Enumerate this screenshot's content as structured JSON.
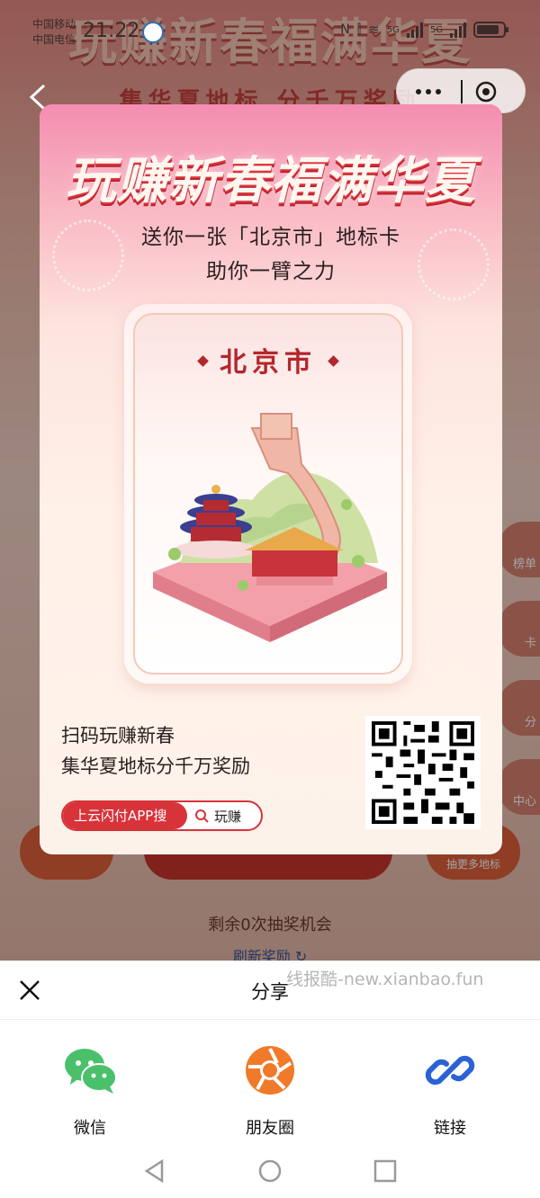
{
  "status_bar": {
    "carrier1": "中国移动",
    "carrier2": "中国电信",
    "time": "21:22",
    "network1": "5G",
    "network2": "5G"
  },
  "background_app": {
    "title": "玩赚新春福满华夏",
    "subtitle": "集华夏地标 分千万奖励",
    "side_buttons": [
      "榜单",
      "卡",
      "分",
      "中心"
    ],
    "bottom_hint": "抽更多地标",
    "remaining_draws": "剩余0次抽奖机会",
    "refresh": "刷新奖励 ↻"
  },
  "share_card": {
    "title": "玩赚新春福满华夏",
    "line1": "送你一张「北京市」地标卡",
    "line2": "助你一臂之力",
    "city": "北京市",
    "scan_text1": "扫码玩赚新春",
    "scan_text2": "集华夏地标分千万奖励",
    "search_app_label": "上云闪付APP搜",
    "search_keyword": "玩赚"
  },
  "share_sheet": {
    "title": "分享",
    "watermark": "线报酷-new.xianbao.fun",
    "options": [
      {
        "label": "微信",
        "icon": "wechat-icon",
        "color": "#4bc06a"
      },
      {
        "label": "朋友圈",
        "icon": "moments-icon",
        "color": "#f07a2a"
      },
      {
        "label": "链接",
        "icon": "link-icon",
        "color": "#2a62d6"
      }
    ]
  },
  "colors": {
    "brand_red": "#d8333a",
    "wechat_green": "#4bc06a"
  }
}
